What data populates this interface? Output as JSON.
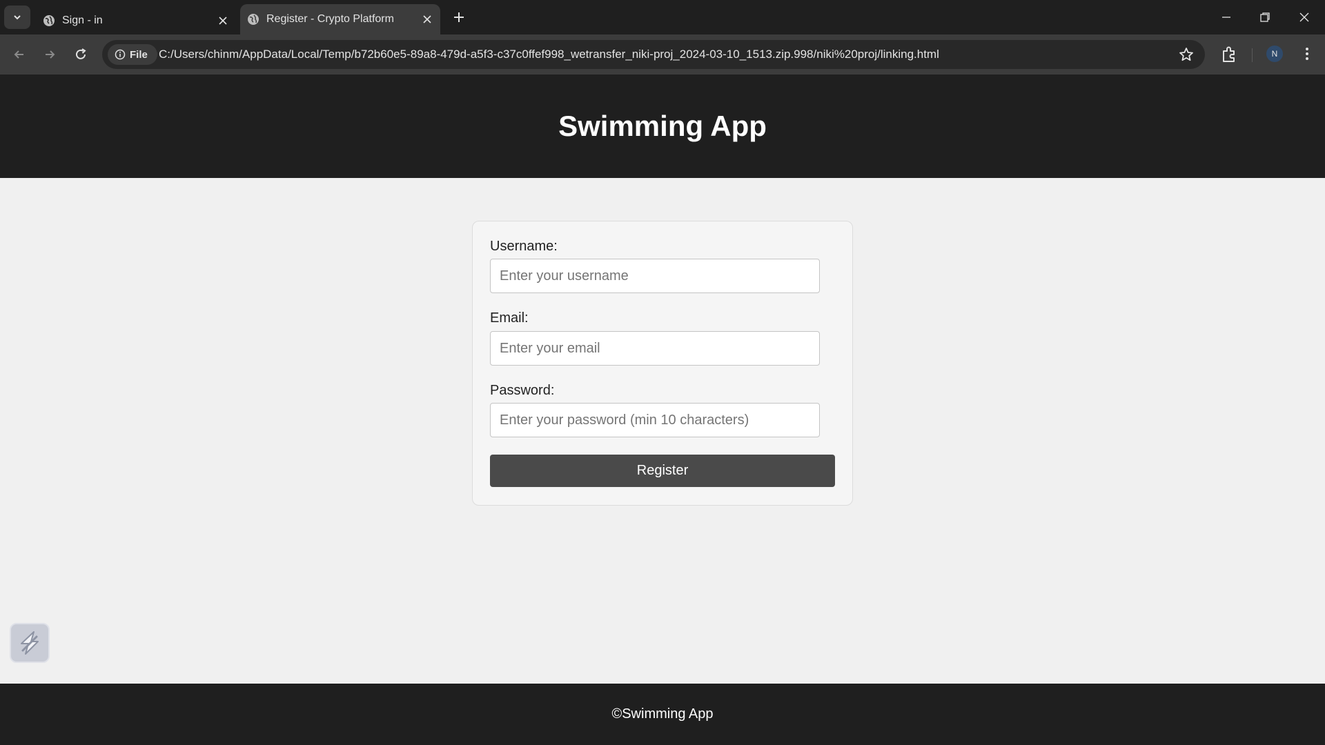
{
  "browser": {
    "tabs": [
      {
        "title": "Sign - in",
        "active": false,
        "icon": "globe-icon"
      },
      {
        "title": "Register - Crypto Platform",
        "active": true,
        "icon": "globe-icon"
      }
    ],
    "address_bar": {
      "chip_label": "File",
      "url": "C:/Users/chinm/AppData/Local/Temp/b72b60e5-89a8-479d-a5f3-c37c0ffef998_wetransfer_niki-proj_2024-03-10_1513.zip.998/niki%20proj/linking.html"
    },
    "profile_initial": "N"
  },
  "header": {
    "title": "Swimming App"
  },
  "form": {
    "username": {
      "label": "Username:",
      "placeholder": "Enter your username",
      "value": ""
    },
    "email": {
      "label": "Email:",
      "placeholder": "Enter your email",
      "value": ""
    },
    "password": {
      "label": "Password:",
      "placeholder": "Enter your password (min 10 characters)",
      "value": ""
    },
    "submit_label": "Register"
  },
  "footer": {
    "text": "©Swimming App"
  },
  "colors": {
    "chrome_dark": "#1f1f1f",
    "toolbar": "#3c3c3c",
    "page_bg": "#f0f0f0",
    "button": "#4a4a4a"
  }
}
